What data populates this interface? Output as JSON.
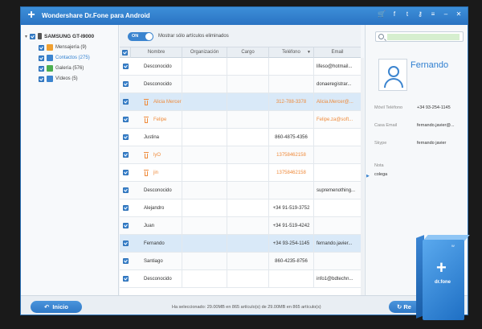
{
  "window": {
    "title": "Wondershare Dr.Fone para Android"
  },
  "titlebar_icons": [
    "cart-icon",
    "facebook-icon",
    "twitter-icon",
    "key-icon",
    "menu-icon",
    "minimize-icon",
    "close-icon"
  ],
  "titlebar_glyphs": {
    "cart": "🛒",
    "facebook": "f",
    "twitter": "t",
    "key": "⚷",
    "menu": "≡",
    "minimize": "–",
    "close": "✕"
  },
  "sidebar": {
    "device": "SAMSUNG GT-I9000",
    "items": [
      {
        "label": "Mensajería (9)",
        "color": "#f0a030",
        "selected": false
      },
      {
        "label": "Contactos (275)",
        "color": "#3b84cf",
        "selected": true
      },
      {
        "label": "Galería (576)",
        "color": "#4caf50",
        "selected": false
      },
      {
        "label": "Vídeos (5)",
        "color": "#3b84cf",
        "selected": false
      }
    ]
  },
  "toolbar": {
    "toggle_label": "ON",
    "filter_label": "Mostrar sólo artículos eliminados"
  },
  "table": {
    "columns": [
      "Nombre",
      "Organización",
      "Cargo",
      "Teléfono",
      "Email"
    ],
    "rows": [
      {
        "name": "Desconocido",
        "org": "",
        "cargo": "",
        "tel": "",
        "email": "lifeso@hotmail...",
        "deleted": false,
        "selected": false
      },
      {
        "name": "Desconocido",
        "org": "",
        "cargo": "",
        "tel": "",
        "email": "donaeregistrar...",
        "deleted": false,
        "selected": false
      },
      {
        "name": "Alicia Mercer",
        "org": "",
        "cargo": "",
        "tel": "312-788-3378",
        "email": "Alicia.Mercer@...",
        "deleted": true,
        "selected": true
      },
      {
        "name": "Felipe",
        "org": "",
        "cargo": "",
        "tel": "",
        "email": "Felipe.za@soft...",
        "deleted": true,
        "selected": false
      },
      {
        "name": "Justina",
        "org": "",
        "cargo": "",
        "tel": "860-4875-4356",
        "email": "",
        "deleted": false,
        "selected": false
      },
      {
        "name": "lyO",
        "org": "",
        "cargo": "",
        "tel": "13758462158",
        "email": "",
        "deleted": true,
        "selected": false
      },
      {
        "name": "jin",
        "org": "",
        "cargo": "",
        "tel": "13758462158",
        "email": "",
        "deleted": true,
        "selected": false
      },
      {
        "name": "Desconocido",
        "org": "",
        "cargo": "",
        "tel": "",
        "email": "supremenothing...",
        "deleted": false,
        "selected": false
      },
      {
        "name": "Alejandro",
        "org": "",
        "cargo": "",
        "tel": "+34 91-519-3752",
        "email": "",
        "deleted": false,
        "selected": false
      },
      {
        "name": "Juan",
        "org": "",
        "cargo": "",
        "tel": "+34 91-519-4242",
        "email": "",
        "deleted": false,
        "selected": false
      },
      {
        "name": "Fernando",
        "org": "",
        "cargo": "",
        "tel": "+34 93-254-1145",
        "email": "fernando.javier...",
        "deleted": false,
        "selected": true
      },
      {
        "name": "Santiago",
        "org": "",
        "cargo": "",
        "tel": "860-4235-8756",
        "email": "",
        "deleted": false,
        "selected": false
      },
      {
        "name": "Desconocido",
        "org": "",
        "cargo": "",
        "tel": "",
        "email": "info1@bdtechn...",
        "deleted": false,
        "selected": false
      }
    ]
  },
  "detail": {
    "name": "Fernando",
    "fields": [
      {
        "label": "Móvil Teléfono",
        "value": "+34 93-254-1145"
      },
      {
        "label": "Casa Email",
        "value": "fernando.javier@..."
      },
      {
        "label": "Skype",
        "value": "fernando javier"
      },
      {
        "label": "Nota",
        "value": "colega"
      }
    ]
  },
  "footer": {
    "home_label": "Inicio",
    "status": "Ha seleccionado: 29.00MB en 865 artículo(s) de 29.00MB en 865 artículo(s)",
    "recover_label": "Re"
  },
  "product_box": {
    "brand": "dr.fone",
    "maker": "W"
  },
  "colors": {
    "accent": "#2f7fd0",
    "deleted": "#ef8a3a",
    "titlebar": "#2a73c2"
  }
}
